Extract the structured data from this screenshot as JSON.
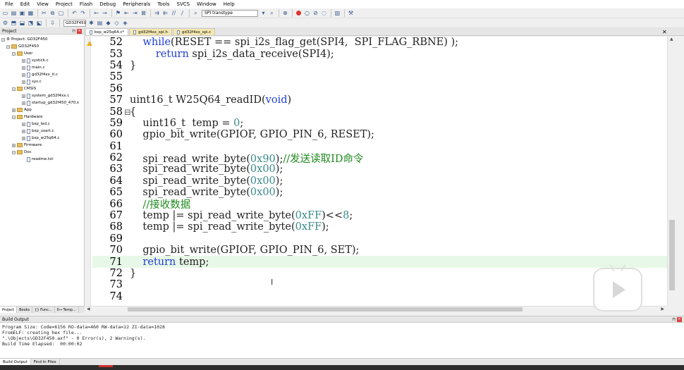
{
  "menu": [
    "File",
    "Edit",
    "View",
    "Project",
    "Flash",
    "Debug",
    "Peripherals",
    "Tools",
    "SVCS",
    "Window",
    "Help"
  ],
  "toolbar": {
    "find_text": "SPI transtype",
    "target": "GD32F450"
  },
  "project_panel": {
    "title": "Project",
    "root": "Project: GD32F450",
    "target": "GD32F450",
    "groups": [
      {
        "name": "User",
        "files": [
          "systick.c",
          "main.c",
          "gd32f4xx_it.c",
          "sys.c"
        ]
      },
      {
        "name": "CMSIS",
        "files": [
          "system_gd32f4xx.c",
          "startup_gd32f450_470.s"
        ]
      },
      {
        "name": "App",
        "files": []
      },
      {
        "name": "Hardware",
        "files": [
          "bsp_led.c",
          "bsp_usart.c",
          "bsp_w25q64.c"
        ]
      },
      {
        "name": "Firmware",
        "files": []
      },
      {
        "name": "Doc",
        "files": [
          "readme.txt"
        ]
      }
    ],
    "tabs": [
      "Project",
      "Books",
      "{} Func...",
      "0→ Temp..."
    ]
  },
  "editor": {
    "tabs": [
      "bsp_w25q64.c*",
      "gd32f4xx_spi.h",
      "gd32f4xx_spi.c"
    ],
    "active_tab": 0,
    "lines": [
      {
        "n": "52",
        "fold": "",
        "parts": [
          [
            "",
            "    "
          ],
          [
            "kw",
            "while"
          ],
          [
            "",
            "(RESET == spi_i2s_flag_get(SPI4,  SPI_FLAG_RBNE) );"
          ]
        ]
      },
      {
        "n": "53",
        "fold": "",
        "parts": [
          [
            "",
            "        "
          ],
          [
            "kw",
            "return"
          ],
          [
            "",
            " spi_i2s_data_receive(SPI4);"
          ]
        ]
      },
      {
        "n": "54",
        "fold": "",
        "parts": [
          [
            "",
            "}"
          ]
        ]
      },
      {
        "n": "55",
        "fold": "",
        "parts": []
      },
      {
        "n": "56",
        "fold": "",
        "parts": []
      },
      {
        "n": "57",
        "fold": "",
        "parts": [
          [
            "",
            "uint16_t W25Q64_readID("
          ],
          [
            "kw",
            "void"
          ],
          [
            "",
            ")"
          ]
        ]
      },
      {
        "n": "58",
        "fold": "⊟",
        "parts": [
          [
            "",
            "{"
          ]
        ]
      },
      {
        "n": "59",
        "fold": "",
        "parts": [
          [
            "",
            "    uint16_t  temp = "
          ],
          [
            "num",
            "0"
          ],
          [
            "",
            ";"
          ]
        ]
      },
      {
        "n": "60",
        "fold": "",
        "parts": [
          [
            "",
            "    gpio_bit_write(GPIOF, GPIO_PIN_6, RESET);"
          ]
        ]
      },
      {
        "n": "61",
        "fold": "",
        "parts": []
      },
      {
        "n": "62",
        "fold": "",
        "parts": [
          [
            "",
            "    spi_read_write_byte("
          ],
          [
            "num",
            "0x90"
          ],
          [
            "",
            ");"
          ],
          [
            "cmt",
            "//发送读取ID命令"
          ]
        ]
      },
      {
        "n": "63",
        "fold": "",
        "parts": [
          [
            "",
            "    spi_read_write_byte("
          ],
          [
            "num",
            "0x00"
          ],
          [
            "",
            ");"
          ]
        ]
      },
      {
        "n": "64",
        "fold": "",
        "parts": [
          [
            "",
            "    spi_read_write_byte("
          ],
          [
            "num",
            "0x00"
          ],
          [
            "",
            ");"
          ]
        ]
      },
      {
        "n": "65",
        "fold": "",
        "parts": [
          [
            "",
            "    spi_read_write_byte("
          ],
          [
            "num",
            "0x00"
          ],
          [
            "",
            ");"
          ]
        ]
      },
      {
        "n": "66",
        "fold": "",
        "parts": [
          [
            "cmt",
            "    //接收数据"
          ]
        ]
      },
      {
        "n": "67",
        "fold": "",
        "parts": [
          [
            "",
            "    temp |= spi_read_write_byte("
          ],
          [
            "num",
            "0xFF"
          ],
          [
            "",
            ")<<"
          ],
          [
            "num",
            "8"
          ],
          [
            "",
            ";"
          ]
        ]
      },
      {
        "n": "68",
        "fold": "",
        "parts": [
          [
            "",
            "    temp |= spi_read_write_byte("
          ],
          [
            "num",
            "0xFF"
          ],
          [
            "",
            ");"
          ]
        ]
      },
      {
        "n": "69",
        "fold": "",
        "parts": []
      },
      {
        "n": "70",
        "fold": "",
        "parts": [
          [
            "",
            "    gpio_bit_write(GPIOF, GPIO_PIN_6, SET);"
          ]
        ]
      },
      {
        "n": "71",
        "fold": "",
        "highlight": true,
        "parts": [
          [
            "",
            "    "
          ],
          [
            "kw",
            "return"
          ],
          [
            "",
            " temp;"
          ]
        ]
      },
      {
        "n": "72",
        "fold": "",
        "parts": [
          [
            "",
            "}"
          ]
        ]
      },
      {
        "n": "73",
        "fold": "",
        "parts": []
      },
      {
        "n": "74",
        "fold": "",
        "parts": []
      }
    ]
  },
  "build_output": {
    "title": "Build Output",
    "lines": [
      "Program Size: Code=6156 RO-data=460 RW-data=12 ZI-data=1028",
      "FromELF: creating hex file...",
      "\".\\Objects\\GD32F450.axf\" - 0 Error(s), 2 Warning(s).",
      "Build Time Elapsed:  00:00:02"
    ],
    "tabs": [
      "Build Output",
      "Find In Files"
    ]
  },
  "colors": {
    "keyword": "#1f3fd0",
    "number": "#3b8a8a",
    "comment": "#1f8a1f",
    "highlight": "#e8f8e8"
  }
}
